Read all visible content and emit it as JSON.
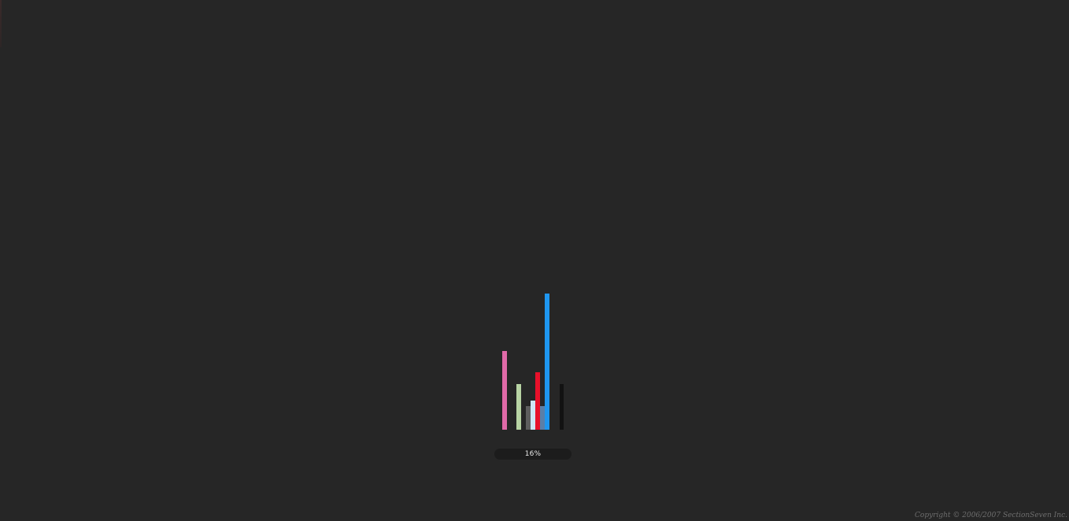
{
  "loader": {
    "progress_label": "16%",
    "progress_fraction": 0.16,
    "bars": [
      {
        "name": "loader-bar-pink",
        "color": "#e06aa8",
        "level": 0.54
      },
      {
        "name": "loader-bar-green",
        "color": "#b8d4a4",
        "level": 0.31
      },
      {
        "name": "loader-bar-gray",
        "color": "#5e5e5e",
        "level": 0.16
      },
      {
        "name": "loader-bar-lightblue",
        "color": "#cfe6f5",
        "level": 0.2
      },
      {
        "name": "loader-bar-red",
        "color": "#e8102a",
        "level": 0.39
      },
      {
        "name": "loader-bar-steelblue",
        "color": "#5a7fa8",
        "level": 0.16
      },
      {
        "name": "loader-bar-blue",
        "color": "#1e96f0",
        "level": 0.93
      },
      {
        "name": "loader-bar-black",
        "color": "#121212",
        "level": 0.31
      }
    ]
  },
  "footer": {
    "copyright": "Copyright © 2006/2007 SectionSeven Inc."
  }
}
